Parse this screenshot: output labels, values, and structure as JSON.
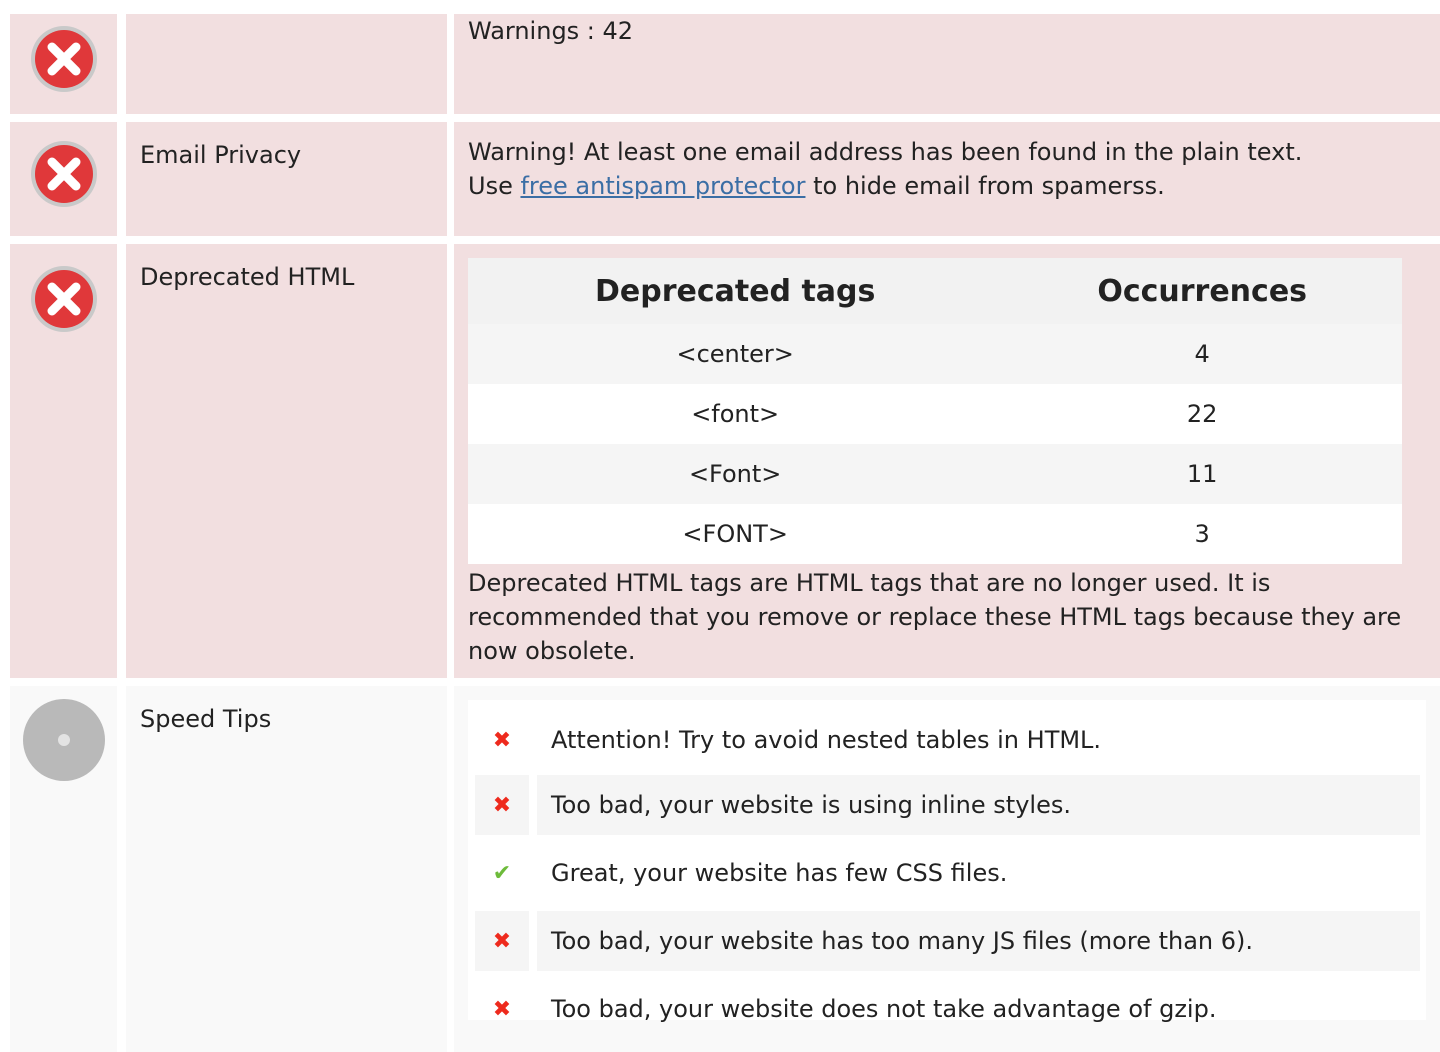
{
  "rows": {
    "warnings": {
      "label": "",
      "text": "Warnings : 42",
      "status": "error"
    },
    "email_privacy": {
      "label": "Email Privacy",
      "line1": "Warning! At least one email address has been found in the plain text.",
      "line2_prefix": "Use ",
      "link_text": "free antispam protector",
      "line2_suffix": " to hide email from spamerss.",
      "status": "error"
    },
    "deprecated_html": {
      "label": "Deprecated HTML",
      "table_headers": [
        "Deprecated tags",
        "Occurrences"
      ],
      "table_rows": [
        [
          "<center>",
          "4"
        ],
        [
          "<font>",
          "22"
        ],
        [
          "<Font>",
          "11"
        ],
        [
          "<FONT>",
          "3"
        ]
      ],
      "description": "Deprecated HTML tags are HTML tags that are no longer used. It is recommended that you remove or replace these HTML tags because they are now obsolete.",
      "status": "error"
    },
    "speed_tips": {
      "label": "Speed Tips",
      "status": "neutral",
      "tips": [
        {
          "text": "Attention! Try to avoid nested tables in HTML.",
          "status": "bad",
          "icon": "cross-icon"
        },
        {
          "text": "Too bad, your website is using inline styles.",
          "status": "bad",
          "icon": "cross-icon"
        },
        {
          "text": "Great, your website has few CSS files.",
          "status": "good",
          "icon": "check-icon"
        },
        {
          "text": "Too bad, your website has too many JS files (more than 6).",
          "status": "bad",
          "icon": "cross-icon"
        },
        {
          "text": "Too bad, your website does not take advantage of gzip.",
          "status": "bad",
          "icon": "cross-icon"
        }
      ]
    }
  },
  "icons": {
    "status_error": "error-x-icon",
    "status_neutral": "neutral-circle-icon"
  },
  "colors": {
    "error_row_bg": "#f2dfe0",
    "neutral_row_bg": "#f9f9f9",
    "error_icon": "#e0383a",
    "link": "#3b6ea5",
    "cross": "#ee2a1d",
    "check": "#6dbb3a"
  }
}
